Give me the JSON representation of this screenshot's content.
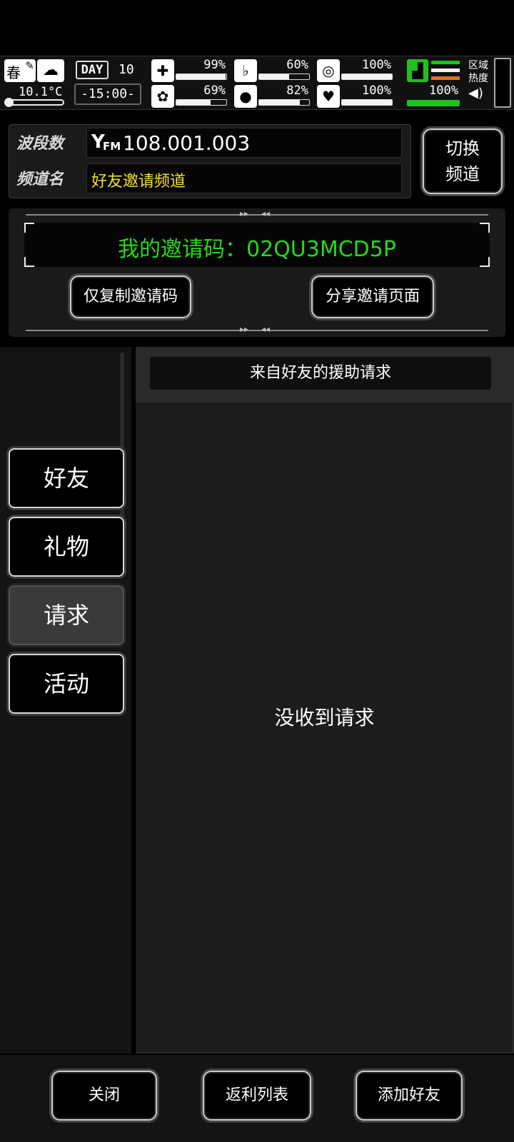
{
  "status": {
    "season": "春",
    "temperature": "10.1°C",
    "day_label": "DAY",
    "day_number": "10",
    "time": "-15:00-",
    "health_pct": "99%",
    "health": 99,
    "hunger_pct": "60%",
    "hunger": 60,
    "stamina_pct": "100%",
    "stamina": 100,
    "brain_pct": "69%",
    "brain": 69,
    "water_pct": "82%",
    "water": 82,
    "mood_pct": "100%",
    "mood": 100,
    "speed_pct": "100%",
    "speed": 100,
    "area_heat_label_1": "区域",
    "area_heat_label_2": "热度",
    "icons": [
      "season-spring-icon",
      "weather-cloudy-icon",
      "medkit-icon",
      "brain-icon",
      "stomach-icon",
      "water-drop-icon",
      "stamina-icon",
      "heart-icon",
      "boot-icon",
      "speaker-icon"
    ],
    "colors": {
      "green": "#22c01e",
      "orange": "#e0702a",
      "white": "#f2f2f2"
    }
  },
  "radio": {
    "band_label": "波段数",
    "band_value": "108.001.003",
    "fm_badge": "FM",
    "channel_label": "频道名",
    "channel_value": "好友邀请频道",
    "switch_button_line1": "切换",
    "switch_button_line2": "频道"
  },
  "invite": {
    "code_text": "我的邀请码：02QU3MCD5P",
    "copy_button": "仅复制邀请码",
    "share_button": "分享邀请页面",
    "code_color": "#27d81f"
  },
  "tabs": {
    "friends": "好友",
    "gifts": "礼物",
    "requests": "请求",
    "events": "活动",
    "active": "requests"
  },
  "content": {
    "header": "来自好友的援助请求",
    "empty_message": "没收到请求"
  },
  "bottom": {
    "close": "关闭",
    "rebate_list": "返利列表",
    "add_friend": "添加好友"
  }
}
